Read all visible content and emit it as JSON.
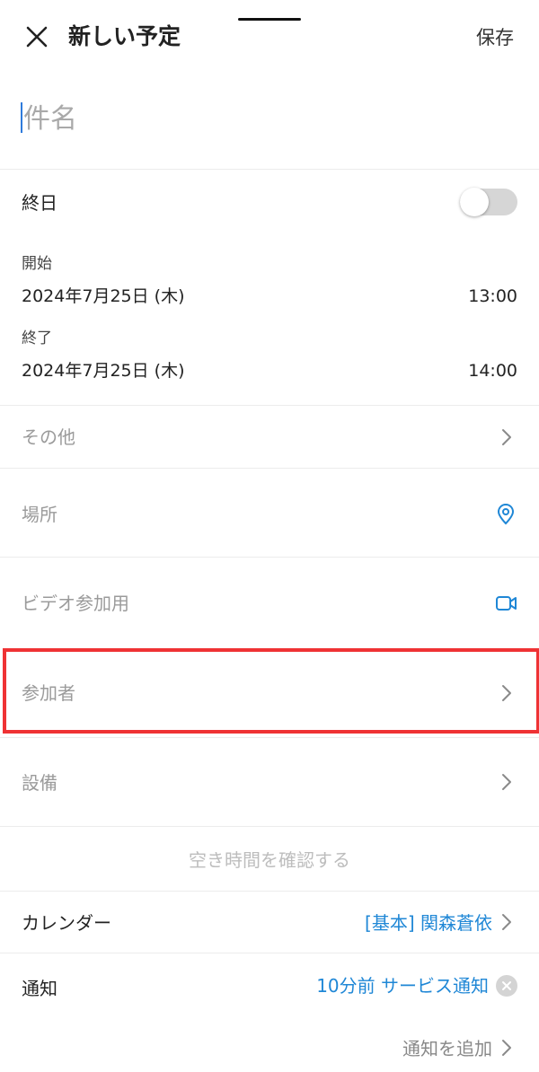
{
  "header": {
    "title": "新しい予定",
    "save_label": "保存"
  },
  "title_field": {
    "placeholder": "件名",
    "value": ""
  },
  "all_day": {
    "label": "終日",
    "enabled": false
  },
  "start": {
    "label": "開始",
    "date": "2024年7月25日 (木)",
    "time": "13:00"
  },
  "end": {
    "label": "終了",
    "date": "2024年7月25日 (木)",
    "time": "14:00"
  },
  "rows": {
    "other": "その他",
    "location": "場所",
    "video": "ビデオ参加用",
    "attendees": "参加者",
    "equipment": "設備"
  },
  "check_availability": "空き時間を確認する",
  "calendar": {
    "label": "カレンダー",
    "value": "[基本] 関森蒼依"
  },
  "notification": {
    "label": "通知",
    "value": "10分前 サービス通知"
  },
  "add_notification": "通知を追加",
  "colors": {
    "accent": "#1f87d6",
    "highlight": "#ef3234",
    "muted": "#9b9b9b"
  },
  "icons": [
    "close-icon",
    "chevron-right-icon",
    "location-pin-icon",
    "video-camera-icon",
    "clear-icon"
  ]
}
